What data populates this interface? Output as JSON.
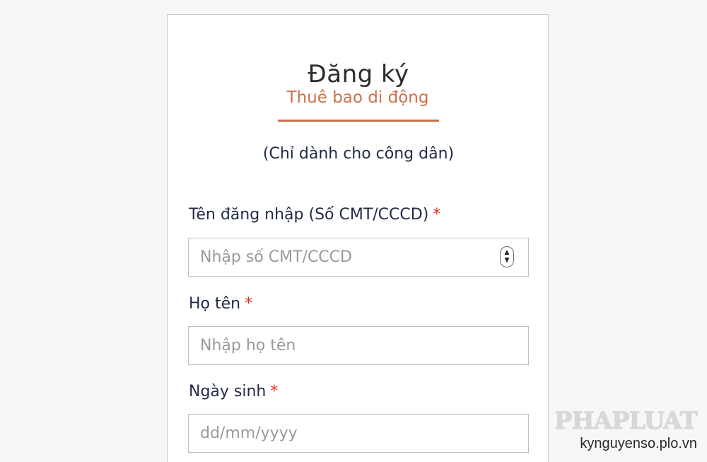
{
  "form": {
    "title": "Đăng ký",
    "tab_label": "Thuê bao di động",
    "note": "(Chỉ dành cho công dân)",
    "required_mark": "*",
    "fields": [
      {
        "label": "Tên đăng nhập (Số CMT/CCCD)",
        "placeholder": "Nhập số CMT/CCCD",
        "value": ""
      },
      {
        "label": "Họ tên",
        "placeholder": "Nhập họ tên",
        "value": ""
      },
      {
        "label": "Ngày sinh",
        "placeholder": "dd/mm/yyyy",
        "value": ""
      }
    ]
  },
  "watermark": {
    "logo_text": "PHAPLUAT",
    "url": "kynguyenso.plo.vn"
  },
  "icons": {
    "spinner_up": "chevron-up-icon",
    "spinner_down": "chevron-down-icon"
  },
  "colors": {
    "accent": "#c9714a",
    "required": "#e0322c",
    "text": "#1f2a44",
    "placeholder": "#9a9a9a",
    "border": "#bfbfbf",
    "background": "#f7f7f7"
  }
}
